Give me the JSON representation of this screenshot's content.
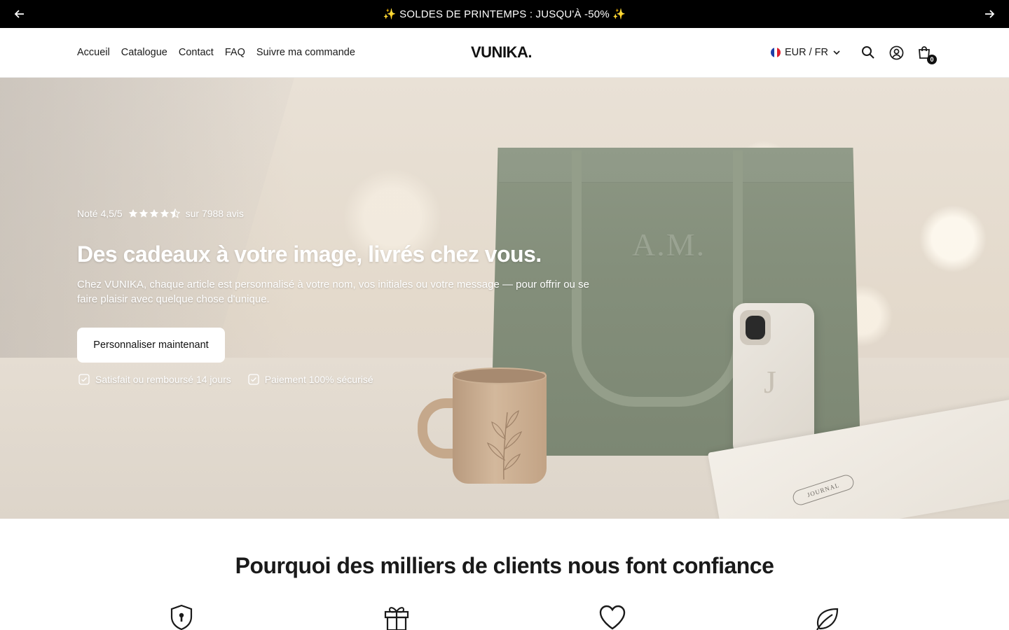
{
  "announcement": {
    "text": "✨ SOLDES DE PRINTEMPS : JUSQU'À -50% ✨",
    "prev_icon": "arrow-left-icon",
    "next_icon": "arrow-right-icon"
  },
  "header": {
    "nav": [
      "Accueil",
      "Catalogue",
      "Contact",
      "FAQ",
      "Suivre ma commande"
    ],
    "logo": "VUNIKA.",
    "currency": "EUR / FR",
    "cart_count": "0",
    "icons": [
      "search-icon",
      "account-icon",
      "cart-icon"
    ]
  },
  "hero": {
    "rating_prefix": "Noté 4,5/5",
    "rating_value": 4.5,
    "rating_suffix": "sur 7988 avis",
    "title": "Des cadeaux à votre image, livrés chez vous.",
    "subtitle": "Chez VUNIKA, chaque article est personnalisé à votre nom, vos initiales ou votre message — pour offrir ou se faire plaisir avec quelque chose d'unique.",
    "cta": "Personnaliser maintenant",
    "guarantees": [
      "Satisfait ou remboursé 14 jours",
      "Paiement 100% sécurisé"
    ],
    "image_text": {
      "monogram": "A.M.",
      "phone_letter": "J",
      "journal": "JOURNAL"
    }
  },
  "trust": {
    "title": "Pourquoi des milliers de clients nous font confiance",
    "icons": [
      "shield-lock-icon",
      "gift-icon",
      "heart-icon",
      "leaf-icon"
    ]
  },
  "colors": {
    "announcement_bg": "#000000",
    "text": "#1a1a1a",
    "tote": "#858f7c"
  }
}
